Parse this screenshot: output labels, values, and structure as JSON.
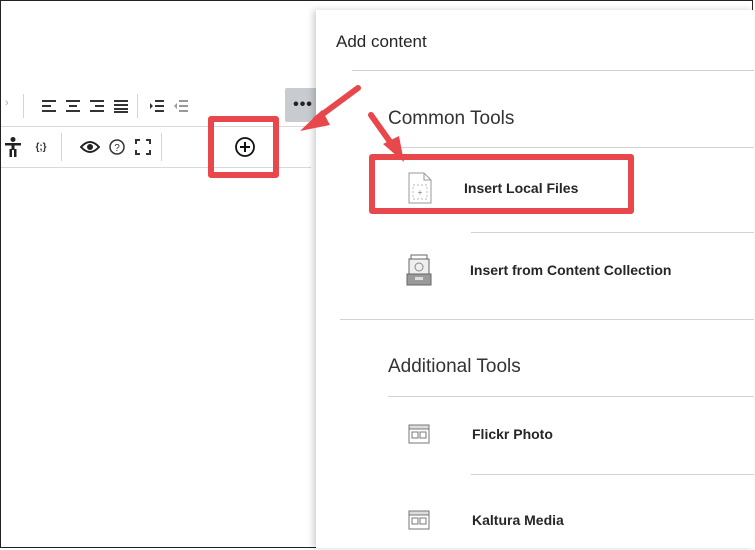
{
  "panel": {
    "title": "Add content",
    "sections": [
      {
        "heading": "Common Tools",
        "items": [
          {
            "label": "Insert Local Files",
            "icon": "blank-file-icon"
          },
          {
            "label": "Insert from Content Collection",
            "icon": "content-collection-icon"
          }
        ]
      },
      {
        "heading": "Additional Tools",
        "items": [
          {
            "label": "Flickr Photo",
            "icon": "media-window-icon"
          },
          {
            "label": "Kaltura Media",
            "icon": "media-window-icon"
          }
        ]
      }
    ]
  },
  "toolbar": {
    "row1": [
      "align-left-icon",
      "align-center-icon",
      "align-right-icon",
      "justify-icon",
      "indent-icon",
      "outdent-icon",
      "more-options-icon"
    ],
    "row2": [
      "accessibility-icon",
      "code-icon",
      "preview-icon",
      "help-icon",
      "fullscreen-icon",
      "add-content-icon"
    ]
  },
  "annotation": {
    "highlight_color": "#e8474c"
  }
}
